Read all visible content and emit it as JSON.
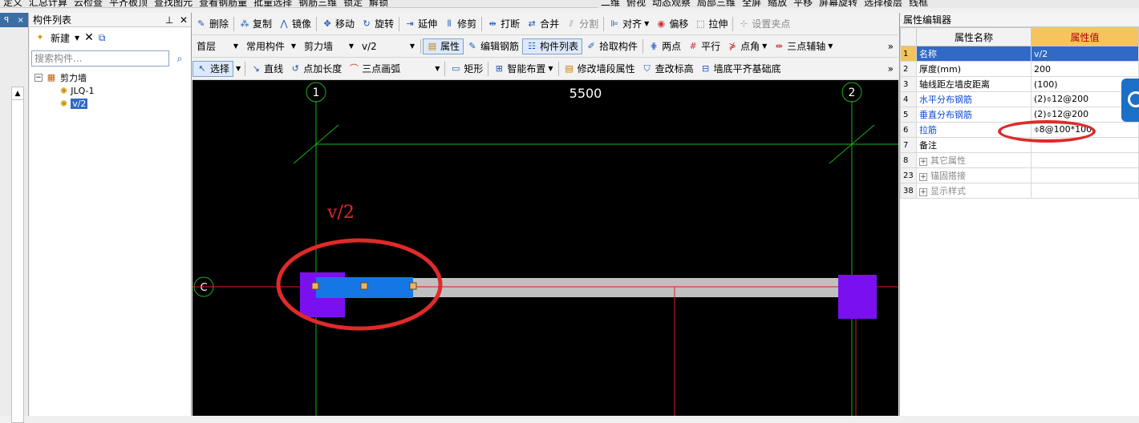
{
  "top_menu": {
    "left": [
      "定义",
      "汇总计算",
      "云检查",
      "平齐板顶",
      "查找图元",
      "查看钢筋量",
      "批量选择",
      "钢筋三维",
      "锁定",
      "解锁"
    ],
    "right": [
      "二维",
      "俯视",
      "动态观察",
      "局部三维",
      "全屏",
      "缩放",
      "平移",
      "屏幕旋转",
      "选择楼层",
      "线框"
    ]
  },
  "left_strip": {
    "pin": "ꟼ",
    "close": "×"
  },
  "component_list": {
    "title": "构件列表",
    "new_label": "新建",
    "search_placeholder": "搜索构件...",
    "tree": {
      "root": "剪力墙",
      "expander": "−",
      "children": [
        "JLQ-1",
        "v/2"
      ]
    }
  },
  "toolbar1": [
    "删除",
    "复制",
    "镜像",
    "移动",
    "旋转",
    "延伸",
    "修剪",
    "打断",
    "合并",
    "分割",
    "对齐",
    "偏移",
    "拉伸",
    "设置夹点"
  ],
  "toolbar2": {
    "floor": "首层",
    "category": "常用构件",
    "type": "剪力墙",
    "component": "v/2",
    "buttons": [
      "属性",
      "编辑钢筋",
      "构件列表",
      "拾取构件",
      "两点",
      "平行",
      "点角",
      "三点辅轴"
    ]
  },
  "toolbar3": {
    "select": "选择",
    "buttons": [
      "直线",
      "点加长度",
      "三点画弧",
      "矩形",
      "智能布置",
      "修改墙段属性",
      "查改标高",
      "墙底平齐基础底"
    ]
  },
  "canvas": {
    "axis_left": "1",
    "axis_right": "2",
    "axis_row": "C",
    "dimension": "5500",
    "wall_label": "v/2",
    "colors": {
      "background": "#000000",
      "wall_gray": "#c0c0c0",
      "wall_selected": "#1577e6",
      "column": "#7a10f0",
      "axis_line": "#1bb01b",
      "ref_line": "#e01a1a",
      "annotation": "#e02a2a"
    }
  },
  "property_editor": {
    "title": "属性编辑器",
    "col_name": "属性名称",
    "col_value": "属性值",
    "rows": [
      {
        "num": "1",
        "name": "名称",
        "value": "v/2"
      },
      {
        "num": "2",
        "name": "厚度(mm)",
        "value": "200"
      },
      {
        "num": "3",
        "name": "轴线距左墙皮距离",
        "value": "(100)"
      },
      {
        "num": "4",
        "name": "水平分布钢筋",
        "value": "(2)⌽12@200"
      },
      {
        "num": "5",
        "name": "垂直分布钢筋",
        "value": "(2)⌽12@200"
      },
      {
        "num": "6",
        "name": "拉筋",
        "value": "⌽8@100*100"
      },
      {
        "num": "7",
        "name": "备注",
        "value": ""
      },
      {
        "num": "8",
        "name": "其它属性",
        "value": ""
      },
      {
        "num": "23",
        "name": "锚固搭接",
        "value": ""
      },
      {
        "num": "38",
        "name": "显示样式",
        "value": ""
      }
    ]
  }
}
